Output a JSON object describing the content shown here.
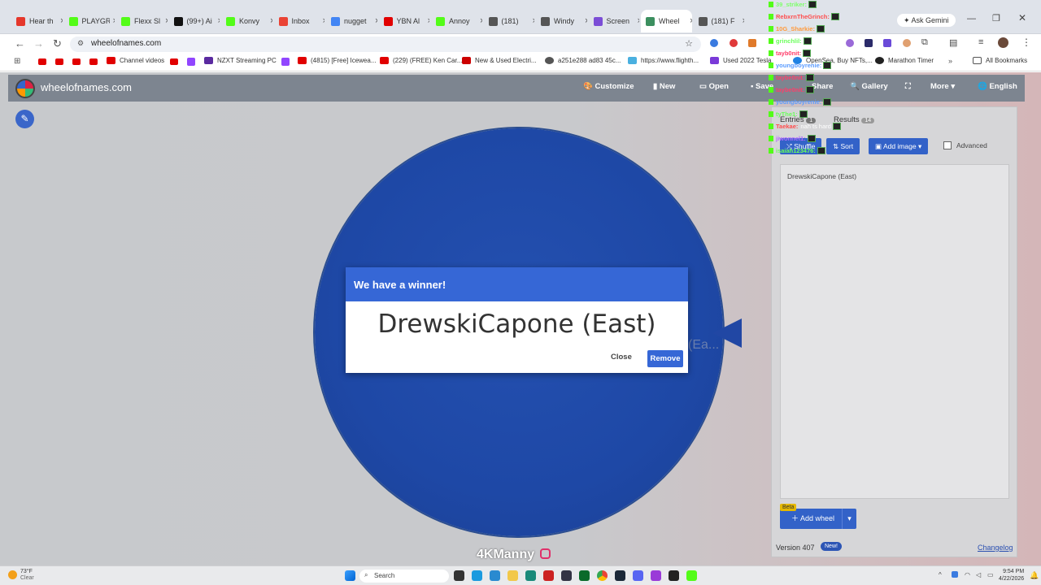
{
  "browser": {
    "tabs": [
      {
        "title": "Hear th",
        "color": "#e5372b"
      },
      {
        "title": "PLAYGR",
        "color": "#53fc18"
      },
      {
        "title": "Flexx Sl",
        "color": "#53fc18"
      },
      {
        "title": "(99+) Ai",
        "color": "#111111"
      },
      {
        "title": "Konvy",
        "color": "#53fc18"
      },
      {
        "title": "Inbox",
        "color": "#ea4335"
      },
      {
        "title": "nugget",
        "color": "#4285f4"
      },
      {
        "title": "YBN Al",
        "color": "#e10000"
      },
      {
        "title": "Annoy",
        "color": "#53fc18"
      },
      {
        "title": "(181)",
        "color": "#555555"
      },
      {
        "title": "Windy",
        "color": "#555555"
      },
      {
        "title": "Screen",
        "color": "#7b4dd6"
      },
      {
        "title": "Wheel",
        "color": "#3c8f5f"
      },
      {
        "title": "(181) F",
        "color": "#555555"
      }
    ],
    "ask_gemini": "Ask Gemini",
    "url": "wheelofnames.com",
    "bookmarks": [
      "Channel videos",
      "NZXT Streaming PC",
      "(4815) [Free] Icewea...",
      "(229) (FREE) Ken Car...",
      "New & Used Electri...",
      "a251e288 ad83 45c...",
      "https://www.flighth...",
      "Used 2022 Tesla",
      "OpenSea, Buy NFTs,...",
      "Marathon Timer"
    ],
    "all_bookmarks": "All Bookmarks"
  },
  "app": {
    "site_title": "wheelofnames.com",
    "menu": {
      "customize": "Customize",
      "new": "New",
      "open": "Open",
      "save": "Save",
      "share": "Share",
      "gallery": "Gallery",
      "more": "More",
      "language": "English"
    },
    "wheel_label_partial": "(Ea...",
    "dialog": {
      "title": "We have a winner!",
      "winner": "DrewskiCapone (East)",
      "close": "Close",
      "remove": "Remove"
    },
    "panel": {
      "entries_label": "Entries",
      "entries_count": "1",
      "results_label": "Results",
      "results_count": "14",
      "shuffle": "Shuffle",
      "sort": "Sort",
      "add_image": "Add image",
      "advanced": "Advanced",
      "entry_text": "DrewskiCapone (East)",
      "beta": "Beta",
      "add_wheel": "Add wheel",
      "version": "Version 407",
      "new_badge": "New!",
      "changelog": "Changelog"
    }
  },
  "chat": [
    {
      "name": "39_striker:",
      "msg": "",
      "color": "#7dff6a"
    },
    {
      "name": "RebxrnTheGrinch:",
      "msg": "",
      "color": "#ff4d4d"
    },
    {
      "name": "10G_Sharkie:",
      "msg": "",
      "color": "#ff9a3c"
    },
    {
      "name": "grinchlil:",
      "msg": "",
      "color": "#6aff5a"
    },
    {
      "name": "tayb0nit:",
      "msg": "",
      "color": "#ff3d6a"
    },
    {
      "name": "youngboyrenie:",
      "msg": "",
      "color": "#5a9bff"
    },
    {
      "name": "taybe0nit:",
      "msg": "",
      "color": "#ff3d6a"
    },
    {
      "name": "taybe0nit:",
      "msg": "",
      "color": "#ff3d6a"
    },
    {
      "name": "youngboyrenie:",
      "msg": "",
      "color": "#5a9bff"
    },
    {
      "name": "tyThe1:",
      "msg": "",
      "color": "#6aff5a"
    },
    {
      "name": "Taekae:",
      "msg": "nah ts hard",
      "color": "#ff4d4d"
    },
    {
      "name": "jiwonnel1:",
      "msg": "",
      "color": "#b46aff"
    },
    {
      "name": "isaiah123476:",
      "msg": "",
      "color": "#6aff5a"
    }
  ],
  "watermark": "4KManny",
  "taskbar": {
    "temp": "73°F",
    "condition": "Clear",
    "search": "Search",
    "time": "9:54 PM",
    "date": "4/22/2026"
  }
}
